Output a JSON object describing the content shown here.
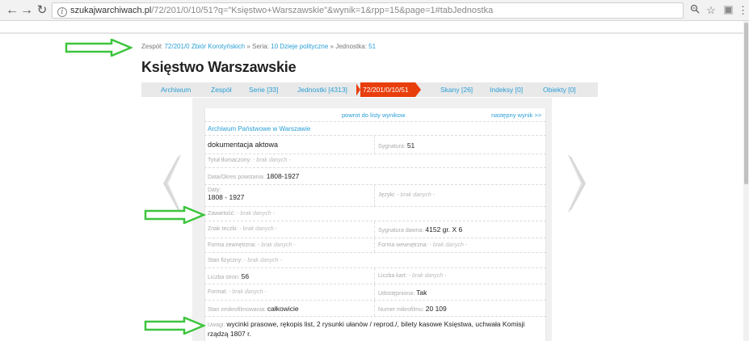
{
  "browser": {
    "url_host": "szukajwarchiwach.pl",
    "url_path": "/72/201/0/10/51?q=\"Księstwo+Warszawskie\"&wynik=1&rpp=15&page=1#tabJednostka"
  },
  "breadcrumb": {
    "zespol_label": "Zespół:",
    "zespol_link": "72/201/0 Zbiór Korotyńskich",
    "sep1": "»",
    "seria_label": "Seria:",
    "seria_link": "10 Dzieje polityczne",
    "sep2": "»",
    "jednostka_label": "Jednostka:",
    "jednostka_link": "51"
  },
  "title": "Księstwo Warszawskie",
  "tabs": [
    {
      "label": "Archiwum"
    },
    {
      "label": "Zespół"
    },
    {
      "label": "Serie [33]"
    },
    {
      "label": "Jednostki [4313]"
    },
    {
      "label": "72/201/0/10/51"
    },
    {
      "label": "Skany [26]"
    },
    {
      "label": "Indeksy [0]"
    },
    {
      "label": "Obiekty [0]"
    }
  ],
  "nav": {
    "back": "powrot do listy wynikow",
    "next": "następny wynik >>"
  },
  "institution": "Archiwum Państwowe w Warszawie",
  "details": {
    "doc_type": "dokumentacja aktowa",
    "sygnatura_label": "Sygnatura:",
    "sygnatura_value": "51",
    "tytul_label": "Tytuł tłumaczony:",
    "tytul_value": "- brak danych -",
    "data_label": "Data/Okres powstania:",
    "data_value": "1808-1927",
    "daty_label": "Daty:",
    "daty_value": "1808 - 1927",
    "jezyki_label": "Języki:",
    "jezyki_value": "- brak danych -",
    "zawartosc_label": "Zawartość:",
    "zawartosc_value": "- brak danych -",
    "znak_label": "Znak teczki:",
    "znak_value": "- brak danych -",
    "sygn_dawna_label": "Sygnatura dawna:",
    "sygn_dawna_value": "4152 gr. X 6",
    "forma_zew_label": "Forma zewnętrzna:",
    "forma_zew_value": "- brak danych -",
    "forma_wew_label": "Forma wewnętrzna:",
    "forma_wew_value": "- brak danych -",
    "stan_label": "Stan fizyczny:",
    "stan_value": "- brak danych -",
    "stron_label": "Liczba stron:",
    "stron_value": "56",
    "kart_label": "Liczba kart:",
    "kart_value": "- brak danych -",
    "format_label": "Format:",
    "format_value": "- brak danych -",
    "udostep_label": "Udostępniona:",
    "udostep_value": "Tak",
    "mikro_label": "Stan zmikrofilmowania:",
    "mikro_value": "całkowicie",
    "nr_mikro_label": "Numer mikrofilmu:",
    "nr_mikro_value": "20 109",
    "uwagi_label": "Uwagi:",
    "uwagi_value": "wycinki prasowe, rękopis list, 2 rysunki ułanów / reprod./, bilety kasowe Księstwa, uchwała Komisji rządzą 1807 r."
  },
  "colors": {
    "link": "#2a9fd6",
    "active_tab": "#e83e0c",
    "annotation_arrow": "#3ec53e"
  }
}
